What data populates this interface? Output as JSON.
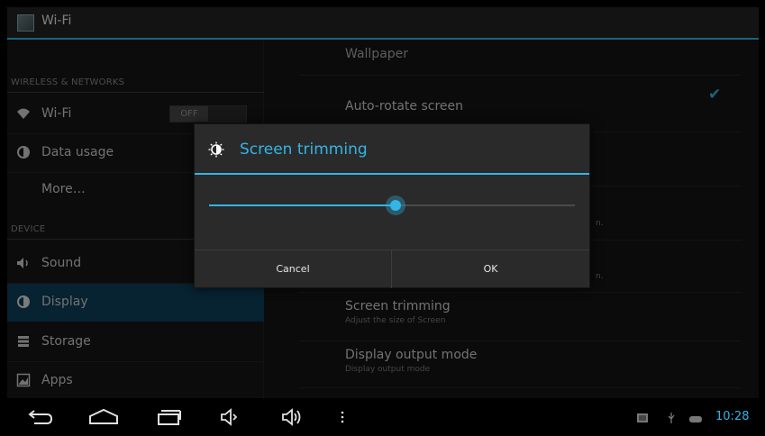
{
  "action_bar": {
    "title": "Wi-Fi",
    "icon": "settings-app-icon"
  },
  "sidebar": {
    "headers": {
      "wireless": "WIRELESS & NETWORKS",
      "device": "DEVICE"
    },
    "items": [
      {
        "label": "Wi-Fi",
        "icon": "wifi-icon",
        "toggle": "OFF"
      },
      {
        "label": "Data usage",
        "icon": "data-usage-icon"
      },
      {
        "label": "More…"
      },
      {
        "label": "Sound",
        "icon": "sound-icon"
      },
      {
        "label": "Display",
        "icon": "display-icon",
        "selected": true
      },
      {
        "label": "Storage",
        "icon": "storage-icon"
      },
      {
        "label": "Apps",
        "icon": "apps-icon"
      }
    ]
  },
  "settings": {
    "wallpaper": "Wallpaper",
    "auto_rotate": "Auto-rotate screen",
    "hidden_sub_1": "n.",
    "hidden_sub_2": "n.",
    "screen_trimming": {
      "title": "Screen trimming",
      "subtitle": "Adjust the size of Screen"
    },
    "display_output": {
      "title": "Display output mode",
      "subtitle": "Display output mode"
    }
  },
  "dialog": {
    "title": "Screen trimming",
    "icon": "brightness-icon",
    "slider_value": 0.51,
    "cancel": "Cancel",
    "ok": "OK"
  },
  "system_bar": {
    "time": "10:28",
    "icons": [
      "back-icon",
      "home-icon",
      "recent-apps-icon",
      "volume-down-icon",
      "volume-up-icon",
      "menu-icon",
      "screenshot-icon",
      "usb-icon",
      "gamepad-icon"
    ]
  },
  "colors": {
    "accent": "#33b5e5",
    "selected_bg": "#0e3f5a"
  }
}
